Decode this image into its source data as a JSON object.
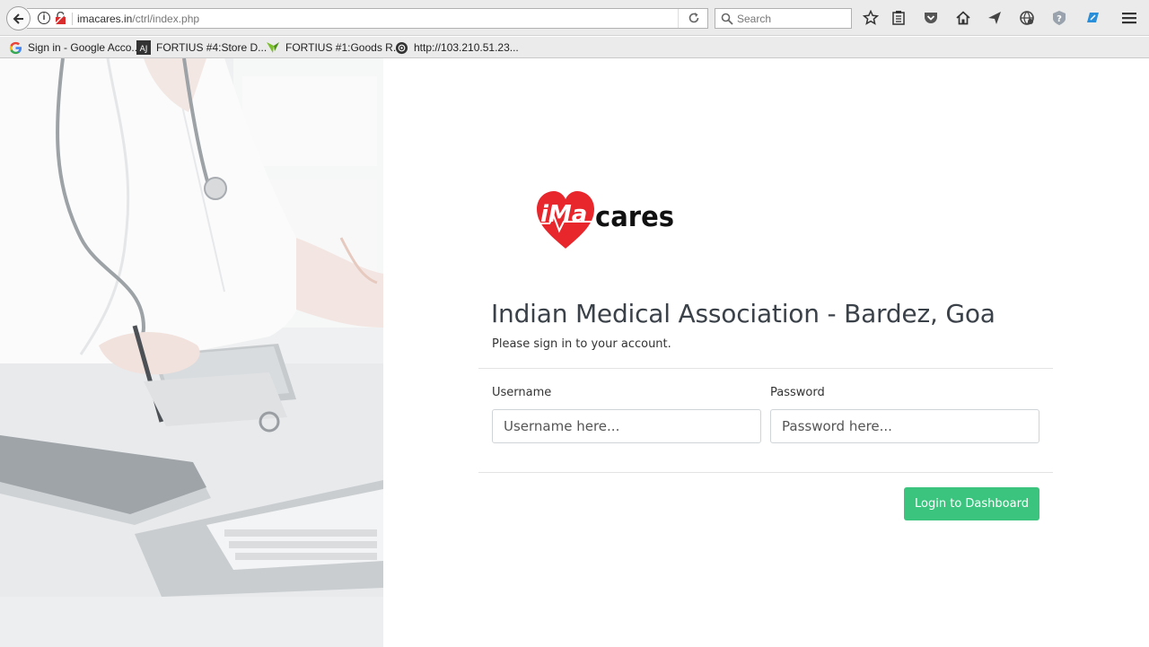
{
  "browser": {
    "url_host": "imacares.in",
    "url_path": "/ctrl/index.php",
    "search_placeholder": "Search",
    "bookmarks": [
      {
        "label": "Sign in - Google Acco...",
        "icon": "google-icon"
      },
      {
        "label": "FORTIUS #4:Store D...",
        "icon": "aj-logo-icon"
      },
      {
        "label": "FORTIUS #1:Goods R...",
        "icon": "green-leaf-icon"
      },
      {
        "label": "http://103.210.51.23...",
        "icon": "globe-icon"
      }
    ]
  },
  "brand": {
    "logo_text_prefix": "iMa",
    "logo_text_suffix": "cares",
    "logo_color": "#e8272d"
  },
  "login": {
    "title": "Indian Medical Association - Bardez, Goa",
    "subtitle": "Please sign in to your account.",
    "username_label": "Username",
    "username_placeholder": "Username here...",
    "password_label": "Password",
    "password_placeholder": "Password here...",
    "submit_label": "Login to Dashboard",
    "accent_color": "#3ac47d"
  }
}
